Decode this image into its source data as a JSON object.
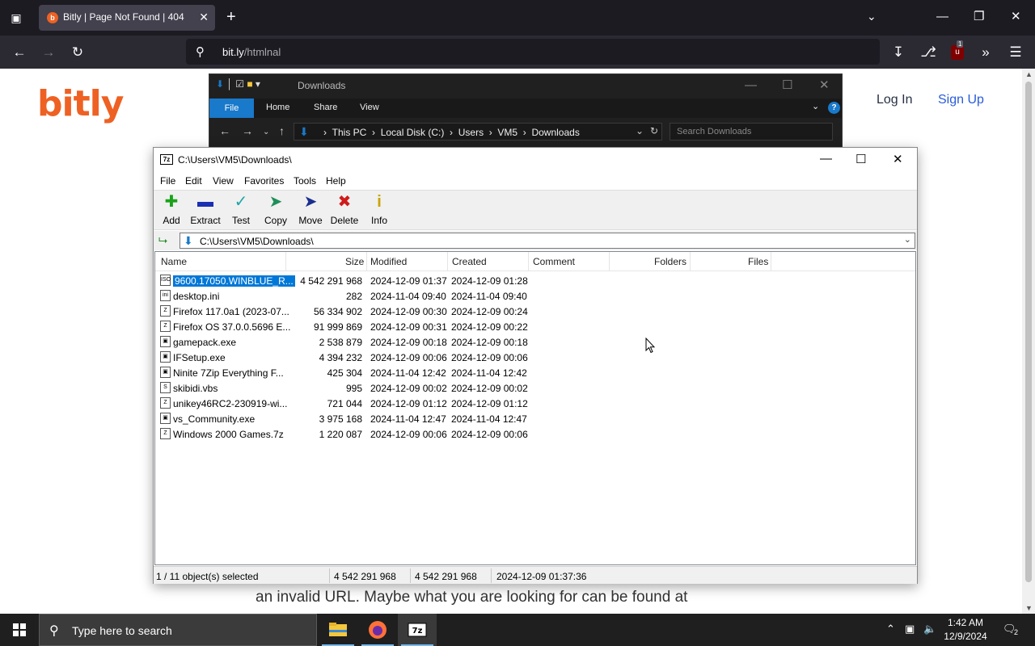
{
  "browser": {
    "tab_title": "Bitly | Page Not Found | 404",
    "url_host": "bit.ly",
    "url_path": "/htmlnal",
    "ublock_count": "1"
  },
  "page": {
    "logo": "bitly",
    "login": "Log In",
    "signup": "Sign Up",
    "body_text": "an invalid URL. Maybe what you are looking for can be found at"
  },
  "explorer": {
    "title": "Downloads",
    "tabs": [
      "File",
      "Home",
      "Share",
      "View"
    ],
    "breadcrumbs": [
      "This PC",
      "Local Disk (C:)",
      "Users",
      "VM5",
      "Downloads"
    ],
    "search_placeholder": "Search Downloads"
  },
  "zip": {
    "title": "C:\\Users\\VM5\\Downloads\\",
    "menu": [
      "File",
      "Edit",
      "View",
      "Favorites",
      "Tools",
      "Help"
    ],
    "toolbar": [
      {
        "label": "Add",
        "icon": "add-icon",
        "color": "#1aa31a"
      },
      {
        "label": "Extract",
        "icon": "extract-icon",
        "color": "#1b2fb3"
      },
      {
        "label": "Test",
        "icon": "test-icon",
        "color": "#22a6a6"
      },
      {
        "label": "Copy",
        "icon": "copy-icon",
        "color": "#1f8f5a"
      },
      {
        "label": "Move",
        "icon": "move-icon",
        "color": "#1b2f8f"
      },
      {
        "label": "Delete",
        "icon": "delete-icon",
        "color": "#d01a1a"
      },
      {
        "label": "Info",
        "icon": "info-icon",
        "color": "#c9a400"
      }
    ],
    "path": "C:\\Users\\VM5\\Downloads\\",
    "columns": [
      "Name",
      "Size",
      "Modified",
      "Created",
      "Comment",
      "Folders",
      "Files"
    ],
    "files": [
      {
        "name": "9600.17050.WINBLUE_R...",
        "size": "4 542 291 968",
        "modified": "2024-12-09 01:37",
        "created": "2024-12-09 01:28",
        "icon": "iso-file-icon",
        "selected": true
      },
      {
        "name": "desktop.ini",
        "size": "282",
        "modified": "2024-11-04 09:40",
        "created": "2024-11-04 09:40",
        "icon": "ini-file-icon"
      },
      {
        "name": "Firefox 117.0a1 (2023-07...",
        "size": "56 334 902",
        "modified": "2024-12-09 00:30",
        "created": "2024-12-09 00:24",
        "icon": "archive-file-icon"
      },
      {
        "name": "Firefox OS 37.0.0.5696 E...",
        "size": "91 999 869",
        "modified": "2024-12-09 00:31",
        "created": "2024-12-09 00:22",
        "icon": "archive-file-icon"
      },
      {
        "name": "gamepack.exe",
        "size": "2 538 879",
        "modified": "2024-12-09 00:18",
        "created": "2024-12-09 00:18",
        "icon": "exe-file-icon"
      },
      {
        "name": "IFSetup.exe",
        "size": "4 394 232",
        "modified": "2024-12-09 00:06",
        "created": "2024-12-09 00:06",
        "icon": "exe-file-icon"
      },
      {
        "name": "Ninite 7Zip Everything F...",
        "size": "425 304",
        "modified": "2024-11-04 12:42",
        "created": "2024-11-04 12:42",
        "icon": "exe-file-icon"
      },
      {
        "name": "skibidi.vbs",
        "size": "995",
        "modified": "2024-12-09 00:02",
        "created": "2024-12-09 00:02",
        "icon": "script-file-icon"
      },
      {
        "name": "unikey46RC2-230919-wi...",
        "size": "721 044",
        "modified": "2024-12-09 01:12",
        "created": "2024-12-09 01:12",
        "icon": "archive-file-icon"
      },
      {
        "name": "vs_Community.exe",
        "size": "3 975 168",
        "modified": "2024-11-04 12:47",
        "created": "2024-11-04 12:47",
        "icon": "exe-file-icon"
      },
      {
        "name": "Windows 2000 Games.7z",
        "size": "1 220 087",
        "modified": "2024-12-09 00:06",
        "created": "2024-12-09 00:06",
        "icon": "archive-file-icon"
      }
    ],
    "status": {
      "selection": "1 / 11 object(s) selected",
      "size": "4 542 291 968",
      "packed": "4 542 291 968",
      "date": "2024-12-09 01:37:36"
    }
  },
  "taskbar": {
    "search_placeholder": "Type here to search",
    "time": "1:42 AM",
    "date": "12/9/2024",
    "notification_count": "2"
  }
}
